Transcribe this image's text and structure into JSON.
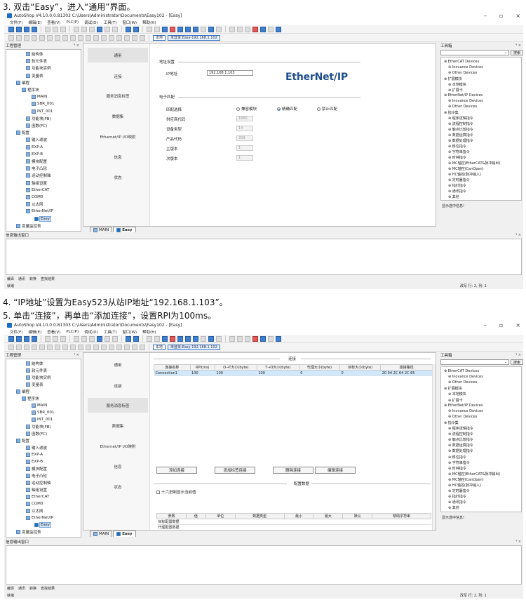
{
  "doc": {
    "step3": "3. 双击“Easy”，进入“通用”界面。",
    "step4": "4. “IP地址”设置为Easy523从站IP地址“192.168.1.103”。",
    "step5": "5. 单击“连接”，再单击“添加连接”，设置RPI为100ms。"
  },
  "app": {
    "title": "AutoShop V4.10.0.0.81303  C:\\Users\\Administrator\\Documents\\Easy102 - [Easy]",
    "menu": [
      "文件(F)",
      "编辑(E)",
      "查看(V)",
      "PLC(P)",
      "调试(D)",
      "工具(T)",
      "窗口(W)",
      "帮助(H)"
    ],
    "btn_local": "本地",
    "btn_login": "未登录:Easy-192.168.1.102",
    "controls": [
      "–",
      "▫",
      "×"
    ]
  },
  "project_tree": {
    "title": "工程管理",
    "items": [
      {
        "label": "结构体",
        "indent": 28,
        "icon": "struct"
      },
      {
        "label": "软元件表",
        "indent": 28,
        "icon": "table"
      },
      {
        "label": "功能块实例",
        "indent": 28,
        "icon": "fb"
      },
      {
        "label": "变量表",
        "indent": 28,
        "icon": "var"
      },
      {
        "label": "编程",
        "indent": 14,
        "icon": "folder"
      },
      {
        "label": "程序块",
        "indent": 22,
        "icon": "folder"
      },
      {
        "label": "MAIN",
        "indent": 36,
        "icon": "prog"
      },
      {
        "label": "SBR_001",
        "indent": 36,
        "icon": "prog"
      },
      {
        "label": "INT_001",
        "indent": 36,
        "icon": "prog"
      },
      {
        "label": "功能块(FB)",
        "indent": 28,
        "icon": "fb"
      },
      {
        "label": "函数(FC)",
        "indent": 28,
        "icon": "fc"
      },
      {
        "label": "配置",
        "indent": 14,
        "icon": "folder"
      },
      {
        "label": "输入滤波",
        "indent": 28,
        "icon": "cfg"
      },
      {
        "label": "EXP-A",
        "indent": 28,
        "icon": "cfg"
      },
      {
        "label": "EXP-B",
        "indent": 28,
        "icon": "cfg"
      },
      {
        "label": "模块配置",
        "indent": 28,
        "icon": "cfg"
      },
      {
        "label": "电子凸轮",
        "indent": 28,
        "icon": "cfg"
      },
      {
        "label": "运动控制轴",
        "indent": 28,
        "icon": "cfg"
      },
      {
        "label": "轴组设置",
        "indent": 28,
        "icon": "cfg"
      },
      {
        "label": "EtherCAT",
        "indent": 28,
        "icon": "cfg"
      },
      {
        "label": "COM0",
        "indent": 28,
        "icon": "cfg"
      },
      {
        "label": "以太网",
        "indent": 28,
        "icon": "cfg"
      },
      {
        "label": "EtherNet/IP",
        "indent": 28,
        "icon": "folder"
      },
      {
        "label": "Easy",
        "indent": 40,
        "icon": "sel",
        "selected": true
      },
      {
        "label": "变量监控表",
        "indent": 14,
        "icon": "folder"
      }
    ]
  },
  "editor": {
    "nav": [
      "通用",
      "连接",
      "服务消息标签",
      "数据集",
      "Ethernet/IP I/O映射",
      "信息",
      "状态"
    ],
    "tabs": [
      {
        "label": "MAIN"
      },
      {
        "label": "Easy"
      }
    ]
  },
  "general": {
    "addr_section": "地址设置",
    "ip_label": "IP地址",
    "ip_value": "192.168.1.103",
    "logo": "EtherNet/IP",
    "ekey_section": "电子匹配",
    "match_label": "匹配选择",
    "radio": [
      {
        "label": "兼容模块",
        "on": false
      },
      {
        "label": "精确匹配",
        "on": true
      },
      {
        "label": "禁止匹配",
        "on": false
      }
    ],
    "fields": [
      {
        "label": "供应商代码",
        "value": "1660"
      },
      {
        "label": "设备类型",
        "value": "14"
      },
      {
        "label": "产品代码",
        "value": "209"
      },
      {
        "label": "主版本",
        "value": "1"
      },
      {
        "label": "次版本",
        "value": "1"
      }
    ]
  },
  "connection": {
    "title": "连接",
    "columns": [
      "连接名称",
      "RPI(ms)",
      "O→T大小(byte)",
      "T→O大小(byte)",
      "代理大小(byte)",
      "目标大小(byte)",
      "连接路径"
    ],
    "rows": [
      [
        "Connection1",
        "100",
        "100",
        "100",
        "0",
        "0",
        "20 04 2C 64 2C 65"
      ]
    ],
    "buttons": [
      "添加连接",
      "添加标签连接",
      "删除连接",
      "编辑连接"
    ],
    "config_title": "配置数据",
    "hex_checkbox": "十六进制显示当前值",
    "param_columns": [
      "参数",
      "值",
      "单位",
      "数据类型",
      "最小",
      "最大",
      "默认",
      "帮助字符串"
    ],
    "param_rows": [
      "目标配置数据",
      "代理配置数据"
    ]
  },
  "toolbox": {
    "title": "工具箱",
    "search": "搜索",
    "items": [
      {
        "label": "EtherCAT Devices",
        "indent": 0
      },
      {
        "label": "Inovance Devices",
        "indent": 6
      },
      {
        "label": "Other Devices",
        "indent": 6
      },
      {
        "label": "扩展模块",
        "indent": 0
      },
      {
        "label": "本地模块",
        "indent": 6
      },
      {
        "label": "扩展卡",
        "indent": 6
      },
      {
        "label": "EtherNet/IP Devices",
        "indent": 0
      },
      {
        "label": "Inovance Devices",
        "indent": 6
      },
      {
        "label": "Other Devices",
        "indent": 6
      },
      {
        "label": "指令集",
        "indent": 0
      },
      {
        "label": "程序逻辑指令",
        "indent": 6
      },
      {
        "label": "流程控制指令",
        "indent": 6
      },
      {
        "label": "触点比较指令",
        "indent": 6
      },
      {
        "label": "数据运算指令",
        "indent": 6
      },
      {
        "label": "数据处理指令",
        "indent": 6
      },
      {
        "label": "移位指令",
        "indent": 6
      },
      {
        "label": "字符串指令",
        "indent": 6
      },
      {
        "label": "时钟指令",
        "indent": 6
      },
      {
        "label": "MC轴控(EtherCAT&脉冲输出)",
        "indent": 6
      },
      {
        "label": "MC轴控(CanOpen)",
        "indent": 6
      },
      {
        "label": "HC轴控(脉冲输入)",
        "indent": 6
      },
      {
        "label": "定时器指令",
        "indent": 6
      },
      {
        "label": "指针指令",
        "indent": 6
      },
      {
        "label": "通讯指令",
        "indent": 6
      },
      {
        "label": "其他",
        "indent": 6
      }
    ],
    "hint": "显示选中信息!"
  },
  "output": {
    "title": "信息输出窗口",
    "tabs": [
      "编译",
      "通讯",
      "转换",
      "查找结果"
    ]
  },
  "status": {
    "left": "就绪",
    "right": "改写  行: 2, 列: 1"
  }
}
